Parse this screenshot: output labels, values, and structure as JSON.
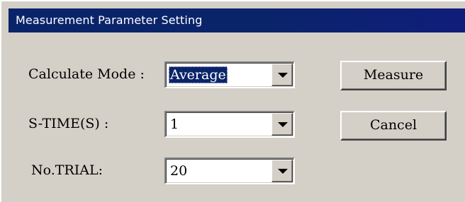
{
  "window": {
    "title": "Measurement Parameter Setting"
  },
  "form": {
    "calculate_mode": {
      "label": "Calculate Mode :",
      "value": "Average"
    },
    "s_time": {
      "label": "S-TIME(S) :",
      "value": "1"
    },
    "no_trial": {
      "label": "No.TRIAL:",
      "value": "20"
    }
  },
  "buttons": {
    "measure": "Measure",
    "cancel": "Cancel"
  },
  "colors": {
    "titlebar": "#0a246a",
    "face": "#d4d0c8",
    "selection": "#0a246a"
  },
  "icons": {
    "dropdown": "chevron-down-icon"
  }
}
